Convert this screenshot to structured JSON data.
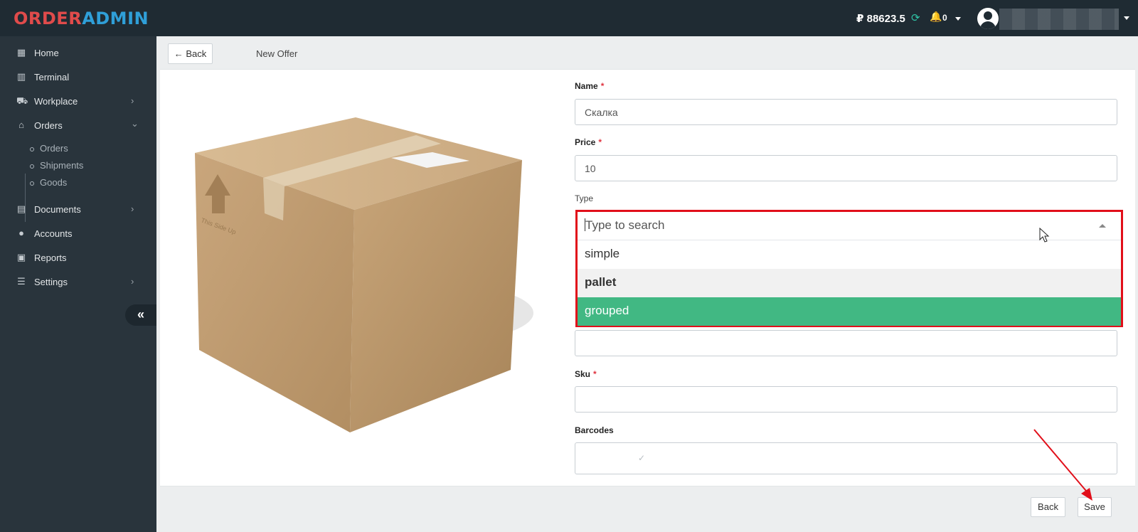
{
  "app": {
    "logo_part1": "ORDER",
    "logo_part2": "ADMIN"
  },
  "header": {
    "balance": "₽ 88623.5",
    "notifications_count": "0"
  },
  "sidebar": {
    "items": [
      {
        "label": "Home",
        "icon": "grid-icon"
      },
      {
        "label": "Terminal",
        "icon": "barcode-icon"
      },
      {
        "label": "Workplace",
        "icon": "truck-icon"
      },
      {
        "label": "Orders",
        "icon": "warehouse-icon"
      },
      {
        "label": "Documents",
        "icon": "document-icon"
      },
      {
        "label": "Accounts",
        "icon": "user-icon"
      },
      {
        "label": "Reports",
        "icon": "report-icon"
      },
      {
        "label": "Settings",
        "icon": "sliders-icon"
      }
    ],
    "orders_subitems": [
      "Orders",
      "Shipments",
      "Goods"
    ]
  },
  "toolbar": {
    "back_label": "Back",
    "title": "New Offer"
  },
  "product_image": {
    "box_text": "This Side Up"
  },
  "form": {
    "name_label": "Name",
    "name_value": "Скалка",
    "price_label": "Price",
    "price_value": "10",
    "type_label": "Type",
    "type_search_placeholder": "Type to search",
    "type_options": [
      "simple",
      "pallet",
      "grouped"
    ],
    "sku_label": "Sku",
    "sku_value": "",
    "barcodes_label": "Barcodes",
    "required_mark": "*"
  },
  "footer": {
    "back_label": "Back",
    "save_label": "Save"
  },
  "colors": {
    "accent_green": "#41b883",
    "highlight_red": "#e10f1a",
    "sidebar": "#29343c",
    "topbar": "#1f2b33"
  }
}
